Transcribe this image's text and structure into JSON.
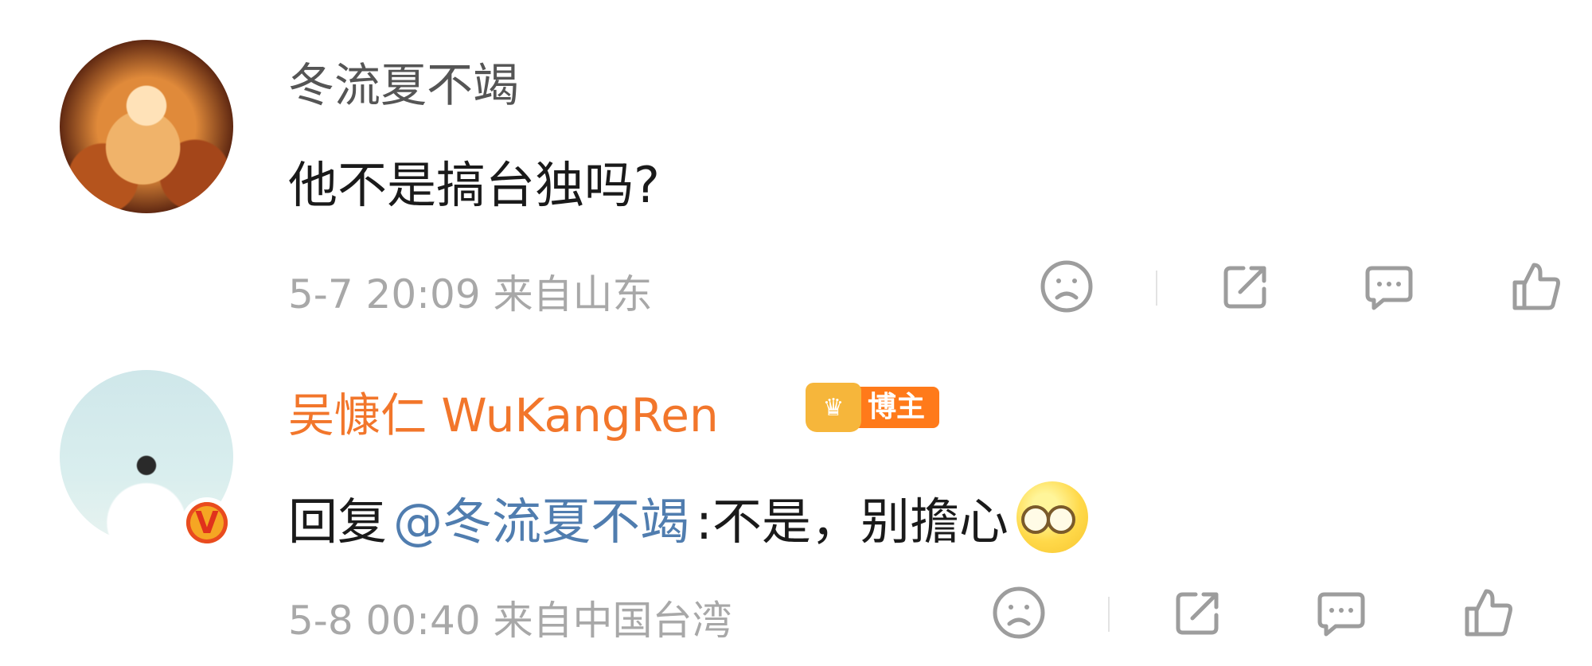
{
  "comments": [
    {
      "username": "冬流夏不竭",
      "text": "他不是搞台独吗?",
      "time": "5-7 20:09",
      "location": "来自山东",
      "verified": false
    },
    {
      "username": "吴慷仁 WuKangRen",
      "badge": "博主",
      "reply_prefix": "回复",
      "mention": "@冬流夏不竭",
      "text": ":不是，别擔心",
      "time": "5-8 00:40",
      "location": "来自中国台湾",
      "verified": true,
      "verified_mark": "V"
    }
  ],
  "icons": [
    "dislike-icon",
    "share-icon",
    "comment-icon",
    "like-icon"
  ],
  "colors": {
    "username_highlight": "#f2762b",
    "mention": "#507daf",
    "meta": "#a8a8a8",
    "icon": "#9d9d9d"
  }
}
